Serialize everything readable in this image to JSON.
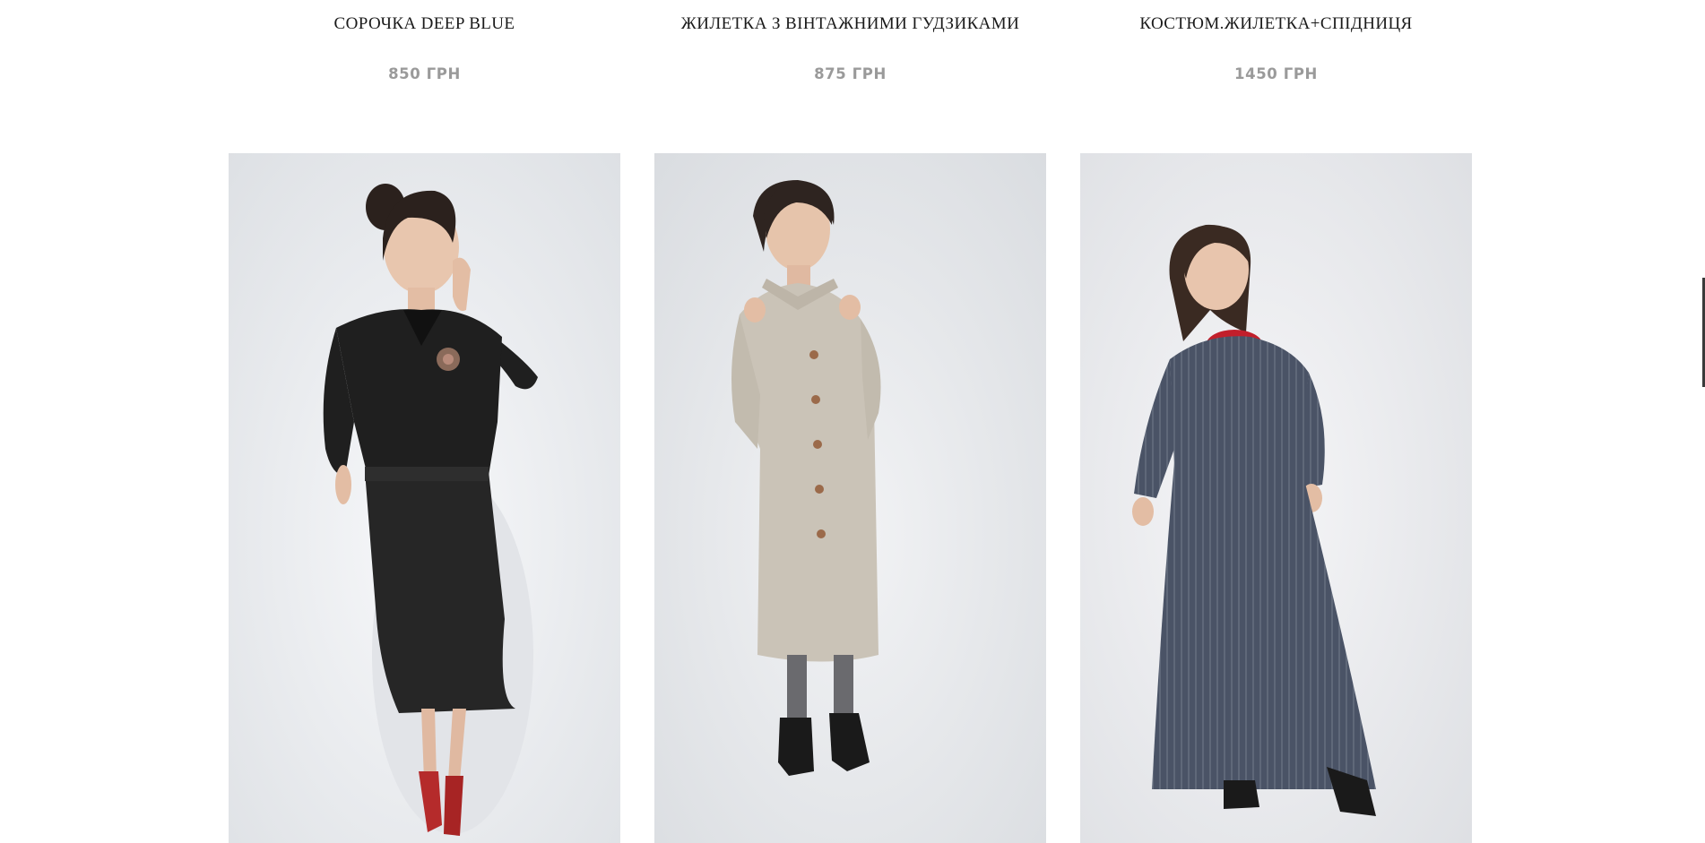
{
  "products": [
    {
      "title": "СОРОЧКА DEEP BLUE",
      "price": "850 ГРН",
      "image_alt": "model-in-black-blouse-and-skirt",
      "garment_color": "#1f1f1f",
      "accent_color": "#b52b2b"
    },
    {
      "title": "ЖИЛЕТКА З ВІНТАЖНИМИ ГУДЗИКАМИ",
      "price": "875 ГРН",
      "image_alt": "model-in-beige-checked-coat-dress",
      "garment_color": "#c9c2b6",
      "accent_color": "#1a1a1a"
    },
    {
      "title": "КОСТЮМ.ЖИЛЕТКА+СПІДНИЦЯ",
      "price": "1450 ГРН",
      "image_alt": "model-in-navy-striped-maxi-dress",
      "garment_color": "#4a5366",
      "accent_color": "#c21f2b"
    }
  ],
  "colors": {
    "title": "#1a1a1a",
    "price": "#9a9a9a",
    "photo_bg": "#eef0f3"
  }
}
